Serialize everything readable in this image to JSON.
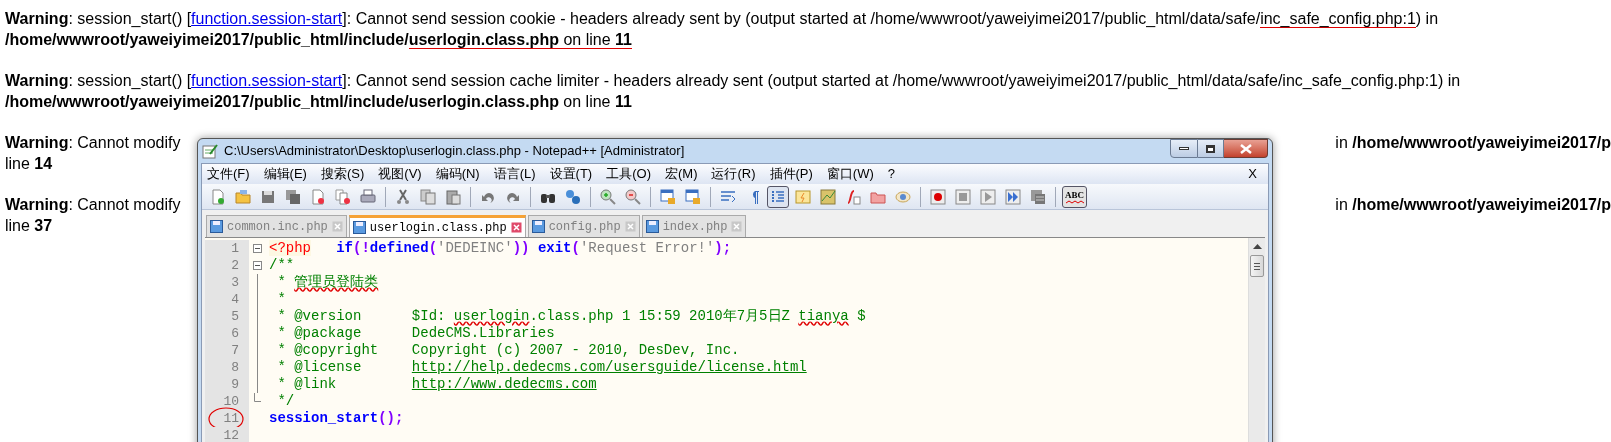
{
  "warnings": [
    {
      "kind": "full",
      "segments": [
        {
          "text": "Warning",
          "bold": true
        },
        {
          "text": ": session_start() ["
        },
        {
          "text": "function.session-start",
          "link": true
        },
        {
          "text": "]: Cannot send session cookie - headers already sent by (output started at /home/wwwroot/yaweiyimei2017/public_html/data/safe/"
        },
        {
          "text": "inc_safe_config.php:1",
          "marked": true
        },
        {
          "text": ") in "
        },
        {
          "text": "/home/wwwroot/yaweiyimei2017/public_html/include/",
          "bold": true
        },
        {
          "text": "userlogin.class.php",
          "bold": true,
          "marked": true
        },
        {
          "text": " on line ",
          "marked": true
        },
        {
          "text": "11",
          "bold": true,
          "marked": true
        }
      ]
    },
    {
      "kind": "full",
      "segments": [
        {
          "text": "Warning",
          "bold": true
        },
        {
          "text": ": session_start() ["
        },
        {
          "text": "function.session-start",
          "link": true
        },
        {
          "text": "]: Cannot send session cache limiter - headers already sent (output started at /home/wwwroot/yaweiyimei2017/public_html/data/safe/inc_safe_config.php:1) in "
        },
        {
          "text": "/home/wwwroot/yaweiyimei2017/public_html/include/userlogin.class.php",
          "bold": true
        },
        {
          "text": " on line "
        },
        {
          "text": "11",
          "bold": true
        }
      ]
    },
    {
      "kind": "covered",
      "start": [
        {
          "text": "Warning",
          "bold": true
        },
        {
          "text": ": Cannot modify"
        }
      ],
      "end": [
        {
          "text": "in "
        },
        {
          "text": "/home/wwwroot/yaweiyimei2017/p",
          "bold": true
        }
      ],
      "tail": [
        {
          "text": "line "
        },
        {
          "text": "14",
          "bold": true
        }
      ]
    },
    {
      "kind": "covered",
      "start": [
        {
          "text": "Warning",
          "bold": true
        },
        {
          "text": ": Cannot modify"
        }
      ],
      "end": [
        {
          "text": "in "
        },
        {
          "text": "/home/wwwroot/yaweiyimei2017/p",
          "bold": true
        }
      ],
      "tail": [
        {
          "text": "line "
        },
        {
          "text": "37",
          "bold": true
        }
      ]
    }
  ],
  "window": {
    "title": "C:\\Users\\Administrator\\Desktop\\userlogin.class.php - Notepad++ [Administrator]",
    "menu": [
      "文件(F)",
      "编辑(E)",
      "搜索(S)",
      "视图(V)",
      "编码(N)",
      "语言(L)",
      "设置(T)",
      "工具(O)",
      "宏(M)",
      "运行(R)",
      "插件(P)",
      "窗口(W)",
      "?"
    ],
    "menu_close": "X",
    "toolbar": {
      "indent_guide_on": true,
      "spell_check": {
        "label": "ABC",
        "on": true
      }
    },
    "tabs": [
      {
        "label": "common.inc.php",
        "selected": false
      },
      {
        "label": "userlogin.class.php",
        "selected": true
      },
      {
        "label": "config.php",
        "selected": false
      },
      {
        "label": "index.php",
        "selected": false
      }
    ],
    "lines": [
      {
        "number": "1",
        "fold": {
          "kind": "open"
        },
        "segments": [
          {
            "kind": "tag",
            "text": "<?php"
          },
          {
            "kind": "keyword",
            "text": "   if"
          },
          {
            "kind": "operator",
            "text": "(!"
          },
          {
            "kind": "keyword",
            "text": "defined"
          },
          {
            "kind": "operator",
            "text": "("
          },
          {
            "kind": "string",
            "text": "'DEDEINC'"
          },
          {
            "kind": "operator",
            "text": "))"
          },
          {
            "kind": "keyword",
            "text": " exit"
          },
          {
            "kind": "operator",
            "text": "("
          },
          {
            "kind": "string",
            "text": "'Request Error!'"
          },
          {
            "kind": "operator",
            "text": ");"
          }
        ]
      },
      {
        "number": "2",
        "fold": {
          "kind": "open"
        },
        "segments": [
          {
            "kind": "comment",
            "text": "/**"
          }
        ]
      },
      {
        "number": "3",
        "fold": {
          "kind": "line"
        },
        "segments": [
          {
            "kind": "comment",
            "text": " * "
          },
          {
            "kind": "comment",
            "text": "管理员登陆类",
            "spell_error": true
          }
        ]
      },
      {
        "number": "4",
        "fold": {
          "kind": "line"
        },
        "segments": [
          {
            "kind": "comment",
            "text": " *"
          }
        ]
      },
      {
        "number": "5",
        "fold": {
          "kind": "line"
        },
        "segments": [
          {
            "kind": "comment",
            "text": " * @version      $Id: "
          },
          {
            "kind": "comment",
            "text": "userlogin",
            "spell_error": true
          },
          {
            "kind": "comment",
            "text": ".class.php 1 15:59 2010年7月5日Z "
          },
          {
            "kind": "comment",
            "text": "tianya",
            "spell_error": true
          },
          {
            "kind": "comment",
            "text": " $"
          }
        ]
      },
      {
        "number": "6",
        "fold": {
          "kind": "line"
        },
        "segments": [
          {
            "kind": "comment",
            "text": " * @package      DedeCMS.Libraries"
          }
        ]
      },
      {
        "number": "7",
        "fold": {
          "kind": "line"
        },
        "segments": [
          {
            "kind": "comment",
            "text": " * @copyright    Copyright (c) 2007 - 2010, DesDev, Inc."
          }
        ]
      },
      {
        "number": "8",
        "fold": {
          "kind": "line"
        },
        "segments": [
          {
            "kind": "comment",
            "text": " * @license      "
          },
          {
            "kind": "link",
            "text": "http://help.dedecms.com/usersguide/license.html"
          }
        ]
      },
      {
        "number": "9",
        "fold": {
          "kind": "line"
        },
        "segments": [
          {
            "kind": "comment",
            "text": " * @link         "
          },
          {
            "kind": "link",
            "text": "http://www.dedecms.com"
          }
        ]
      },
      {
        "number": "10",
        "fold": {
          "kind": "end"
        },
        "segments": [
          {
            "kind": "comment",
            "text": " */"
          }
        ]
      },
      {
        "number": "11",
        "circled": true,
        "segments": [
          {
            "kind": "keyword",
            "text": "session_start"
          },
          {
            "kind": "operator",
            "text": "();"
          }
        ]
      },
      {
        "number": "12"
      }
    ]
  }
}
